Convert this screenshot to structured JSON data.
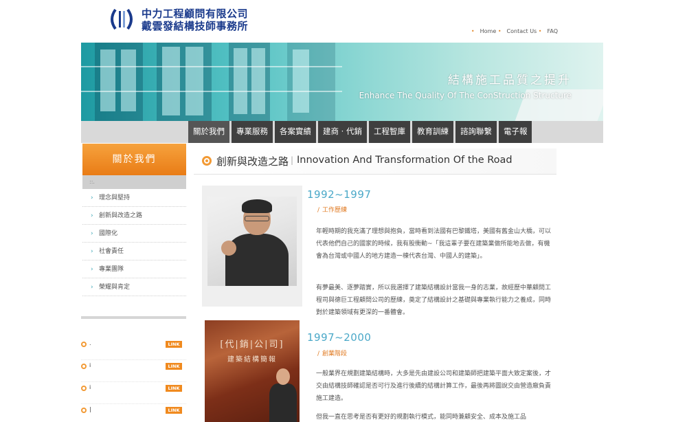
{
  "header": {
    "company_line1": "中力工程顧問有限公司",
    "company_line2": "戴雲發結構技師事務所",
    "topnav": [
      "Home",
      "Contact Us",
      "FAQ"
    ]
  },
  "banner": {
    "title_cn": "結構施工品質之提升",
    "title_en": "Enhance The Quality Of The ConStruction Structure"
  },
  "mainnav": [
    "關於我們",
    "專業服務",
    "各案實績",
    "建商 · 代銷",
    "工程智庫",
    "教育訓練",
    "諮詢聯繫",
    "電子報"
  ],
  "sidebar": {
    "title": "關於我們",
    "bar_text": "::.",
    "items": [
      "理念與堅持",
      "創新與改造之路",
      "國際化",
      "社會責任",
      "專業團隊",
      "榮耀與肯定"
    ],
    "link_label": "LINK",
    "links": [
      ".",
      "i",
      "i",
      "|"
    ]
  },
  "content": {
    "title_cn": "創新與改造之路",
    "separator": "|",
    "title_en": "Innovation And Transformation Of the Road",
    "section1": {
      "year": "1992~1997",
      "subtitle": "工作歷練",
      "para1": "年輕時期的我充滿了理想與抱負，當時看到法國有巴黎鐵塔，美國有舊金山大橋，可以代表他們自己的國家的時候，我有股衝動~「我這輩子要在建築業做所能地去做，有機會為台灣或中國人的地方建造一棟代表台灣、中國人的建築」。",
      "para2": "有夢最美、逐夢踏實，所以我選擇了建築結構設計當我一身的志業，故經歷中華顧問工程司與德巨工程顧問公司的歷練，奠定了結構設計之基礎與專業執行能力之養成，同時對於建築領域有更深的一番體會。"
    },
    "section2": {
      "year": "1997~2000",
      "subtitle": "創業階段",
      "cover_title": "[代|銷|公|司]",
      "cover_sub": "建築結構簡報",
      "para1": "一般業界在規劃建築結構時，大多是先由建設公司和建築師把建築平面大致定案後，才交由結構技師確認是否可行及進行後續的結構計算工作，最後再將圖說交由營造廠負責施工建造。",
      "para2": "但我一直在思考是否有更好的規劃執行模式，能同時兼顧安全、成本及施工品"
    }
  }
}
